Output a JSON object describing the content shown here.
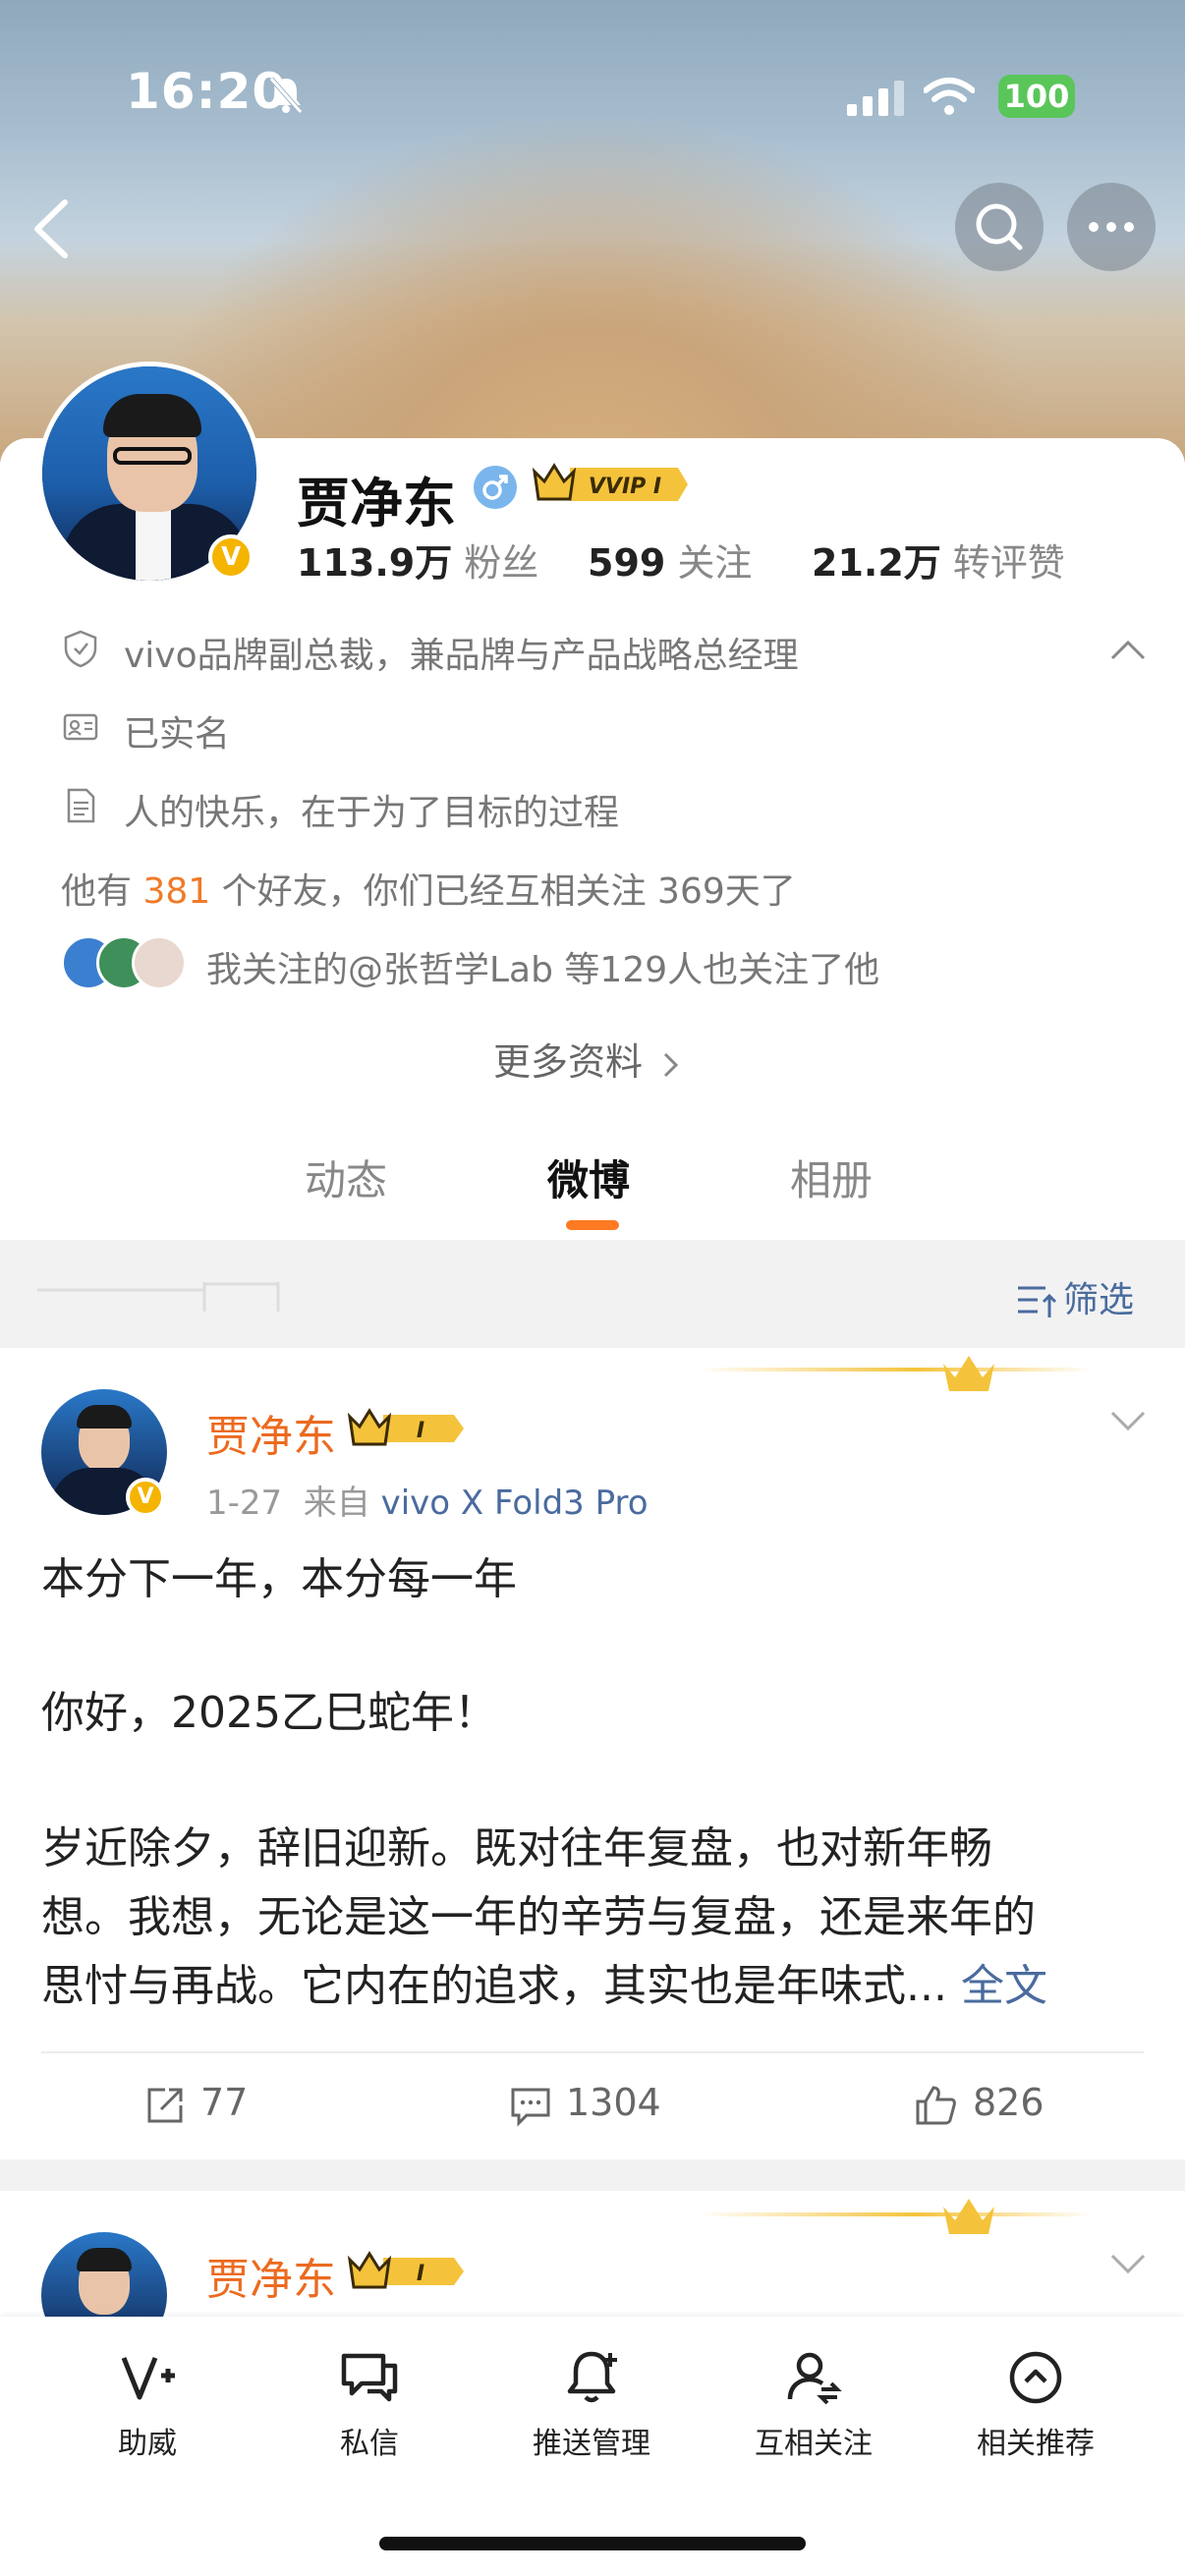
{
  "status_bar": {
    "time": "16:20",
    "battery": "100"
  },
  "profile": {
    "name": "贾净东",
    "vip_label": "VVIP I",
    "stats": [
      {
        "value": "113.9万",
        "label": "粉丝"
      },
      {
        "value": "599",
        "label": "关注"
      },
      {
        "value": "21.2万",
        "label": "转评赞"
      }
    ],
    "title": "vivo品牌副总裁，兼品牌与产品战略总经理",
    "verified": "已实名",
    "bio": "人的快乐，在于为了目标的过程",
    "friends_prefix": "他有 ",
    "friends_count": "381",
    "friends_suffix": " 个好友，你们已经互相关注 369天了",
    "mutual": "我关注的@张哲学Lab 等129人也关注了他",
    "more_info": "更多资料"
  },
  "tabs": [
    {
      "label": "动态",
      "active": false
    },
    {
      "label": "微博",
      "active": true
    },
    {
      "label": "相册",
      "active": false
    }
  ],
  "filter": {
    "label": "筛选"
  },
  "posts": [
    {
      "author": "贾净东",
      "level": "I",
      "date": "1-27",
      "source_prefix": "来自",
      "source": "vivo X Fold3 Pro",
      "lines": [
        "本分下一年，本分每一年",
        "你好，2025乙巳蛇年！",
        "岁近除夕，辞旧迎新。既对往年复盘，也对新年畅",
        "想。我想，无论是这一年的辛劳与复盘，还是来年的",
        "思忖与再战。它内在的追求，其实也是年味式..."
      ],
      "full_text_link": "全文",
      "reposts": "77",
      "comments": "1304",
      "likes": "826"
    },
    {
      "author": "贾净东",
      "level": "I"
    }
  ],
  "bottom_bar": [
    {
      "label": "助威",
      "icon": "v-plus-icon"
    },
    {
      "label": "私信",
      "icon": "message-icon"
    },
    {
      "label": "推送管理",
      "icon": "bell-plus-icon"
    },
    {
      "label": "互相关注",
      "icon": "user-follow-icon"
    },
    {
      "label": "相关推荐",
      "icon": "up-circle-icon"
    }
  ],
  "colors": {
    "accent": "#ff7a22",
    "link": "#4a6b9e",
    "name_orange": "#ec6a1f",
    "vip_gold": "#f4c33b"
  }
}
